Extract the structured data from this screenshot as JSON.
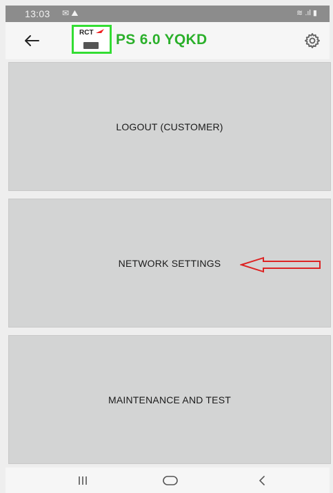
{
  "status_bar": {
    "time": "13:03",
    "left_icons": "✉ ⛰",
    "right_icons": "≋ .ıl ▮"
  },
  "app_bar": {
    "back_icon": "arrow-left-icon",
    "logo_text": "RCT",
    "title": "PS 6.0 YQKD",
    "settings_icon": "gear-icon",
    "title_color": "#2bb02b",
    "logo_border_color": "#33dd33"
  },
  "menu": {
    "items": [
      {
        "label": "LOGOUT (CUSTOMER)"
      },
      {
        "label": "NETWORK SETTINGS"
      },
      {
        "label": "MAINTENANCE AND TEST"
      }
    ],
    "button_color": "#d3d4d4"
  },
  "annotation": {
    "arrow_color": "#dd2222",
    "points_to": "NETWORK SETTINGS"
  },
  "nav_bar": {
    "recents_icon": "recents-icon",
    "home_icon": "home-icon",
    "back_icon": "back-chevron-icon"
  }
}
